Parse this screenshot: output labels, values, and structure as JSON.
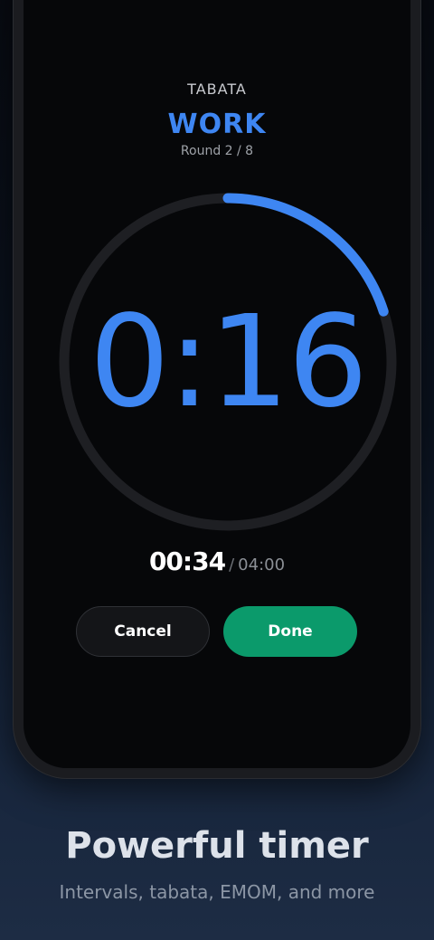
{
  "timer": {
    "mode": "TABATA",
    "phase": "WORK",
    "round": "Round 2 / 8",
    "countdown": "0:16",
    "phase_progress_fraction": 0.2,
    "elapsed": "00:34",
    "separator": "/",
    "total": "04:00"
  },
  "actions": {
    "cancel_label": "Cancel",
    "done_label": "Done"
  },
  "promo": {
    "headline": "Powerful timer",
    "subheadline": "Intervals, tabata, EMOM, and more"
  },
  "colors": {
    "accent_blue": "#3e86f2",
    "done_green": "#0b9a6b",
    "ring_track": "#1e1f23"
  }
}
